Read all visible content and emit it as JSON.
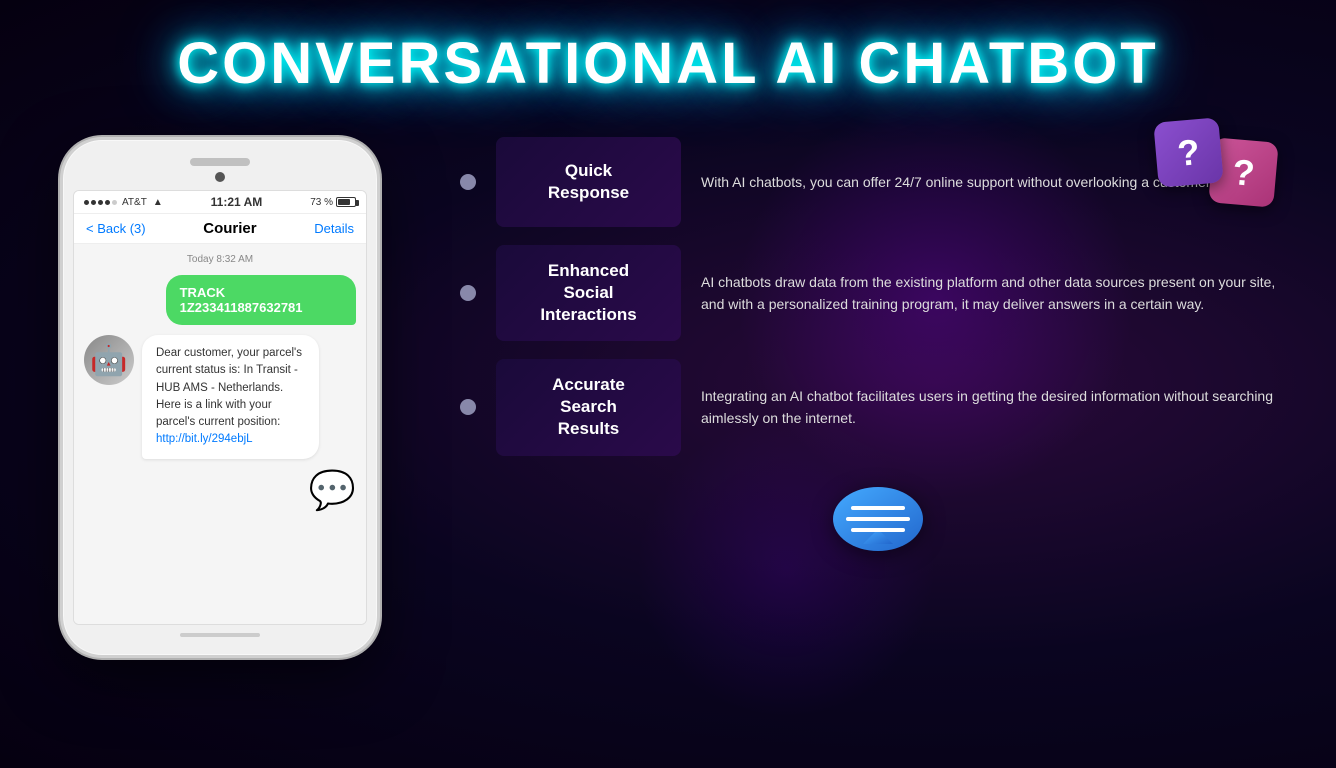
{
  "title": "CONVERSATIONAL AI CHATBOT",
  "question_icon_1": "?",
  "question_icon_2": "?",
  "phone": {
    "carrier": "●●●●○ AT&T",
    "wifi": "▲",
    "time": "11:21 AM",
    "battery_pct": "73 %",
    "nav_back": "< Back (3)",
    "nav_title": "Courier",
    "nav_details": "Details",
    "chat_date": "Today 8:32 AM",
    "message_sent": "TRACK\n1Z233411887632781",
    "message_received": "Dear customer, your parcel's current status is: In Transit - HUB AMS - Netherlands. Here is a link with your parcel's current position: http://bit.ly/294ebjL",
    "emoji": "💬"
  },
  "features": [
    {
      "dot": true,
      "title": "Quick\nResponse",
      "description": "With AI chatbots, you can offer 24/7 online support without overlooking a customer's query."
    },
    {
      "dot": true,
      "title": "Enhanced\nSocial\nInteractions",
      "description": "AI chatbots draw data from the existing platform and other data sources present on your site, and with a personalized training program, it may deliver answers in a certain way."
    },
    {
      "dot": true,
      "title": "Accurate\nSearch\nResults",
      "description": "Integrating an AI chatbot facilitates users in getting the desired information without searching aimlessly on the internet."
    }
  ]
}
